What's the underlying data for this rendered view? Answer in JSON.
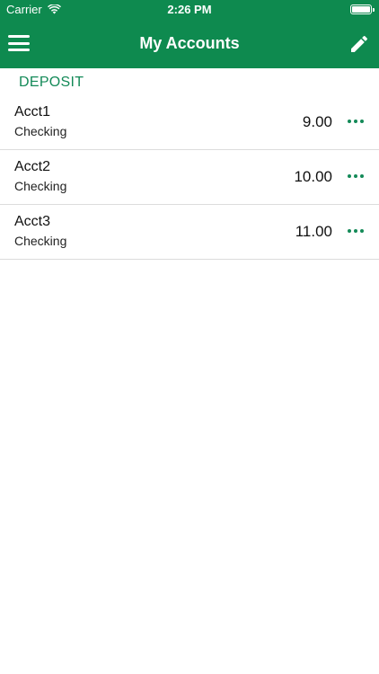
{
  "status_bar": {
    "carrier": "Carrier",
    "time": "2:26 PM"
  },
  "header": {
    "title": "My Accounts",
    "menu_icon": "hamburger-menu-icon",
    "edit_icon": "pencil-icon",
    "background_color": "#0e8a4f"
  },
  "section": {
    "label": "DEPOSIT",
    "accent_color": "#148a58"
  },
  "accounts": [
    {
      "name": "Acct1",
      "type": "Checking",
      "amount": "9.00"
    },
    {
      "name": "Acct2",
      "type": "Checking",
      "amount": "10.00"
    },
    {
      "name": "Acct3",
      "type": "Checking",
      "amount": "11.00"
    }
  ]
}
